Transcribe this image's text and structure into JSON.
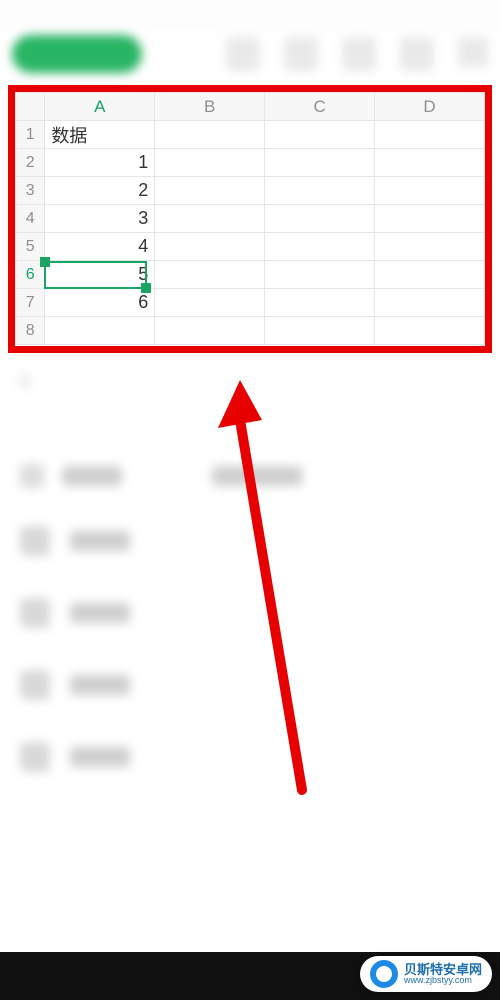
{
  "columns": [
    "A",
    "B",
    "C",
    "D"
  ],
  "rows": [
    {
      "n": "1",
      "a": "数据",
      "type": "txt"
    },
    {
      "n": "2",
      "a": "1",
      "type": "num"
    },
    {
      "n": "3",
      "a": "2",
      "type": "num"
    },
    {
      "n": "4",
      "a": "3",
      "type": "num"
    },
    {
      "n": "5",
      "a": "4",
      "type": "num"
    },
    {
      "n": "6",
      "a": "5",
      "type": "num",
      "active": true
    },
    {
      "n": "7",
      "a": "6",
      "type": "num"
    },
    {
      "n": "8",
      "a": "",
      "type": "num"
    }
  ],
  "active_col": "A",
  "below_row": "9",
  "watermark": {
    "title": "贝斯特安卓网",
    "url": "www.zjbstyy.com"
  }
}
